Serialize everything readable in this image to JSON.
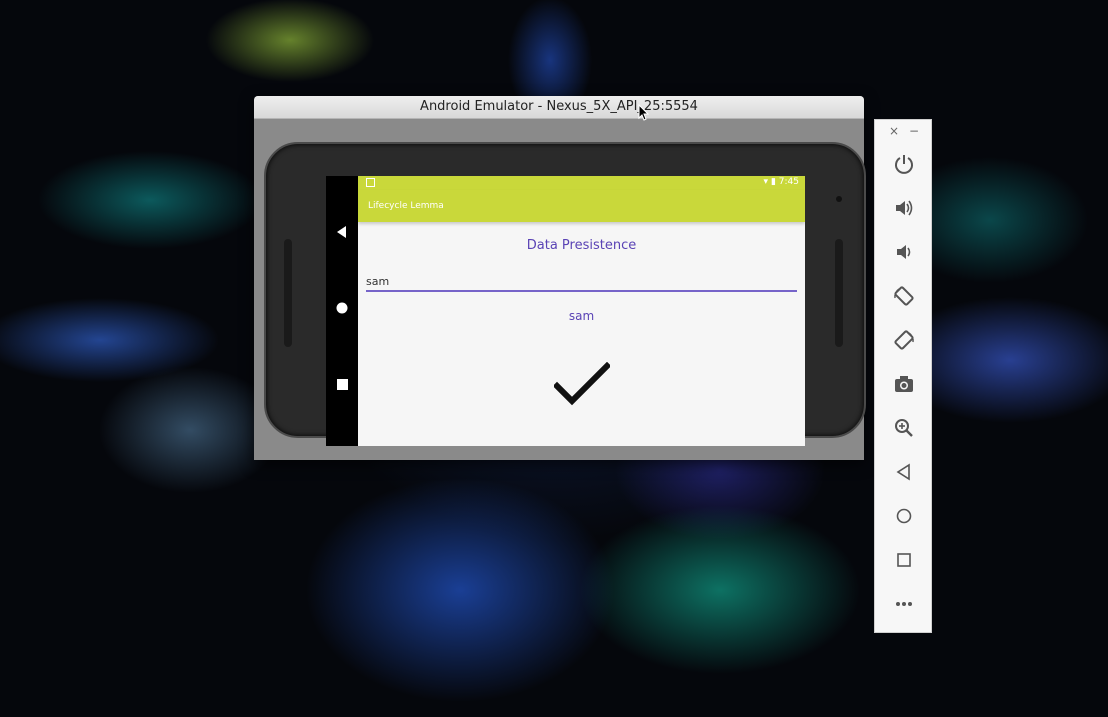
{
  "window": {
    "title": "Android Emulator - Nexus_5X_API_25:5554"
  },
  "status_bar": {
    "time": "7:45"
  },
  "app": {
    "title": "Lifecycle Lemma",
    "heading": "Data Presistence",
    "input_value": "sam",
    "echo_text": "sam"
  },
  "toolbar": {
    "close_glyph": "×",
    "minimize_glyph": "−",
    "buttons": [
      "power-icon",
      "volume-up-icon",
      "volume-down-icon",
      "rotate-left-icon",
      "rotate-right-icon",
      "camera-icon",
      "zoom-icon",
      "back-icon",
      "home-icon",
      "overview-icon",
      "more-icon"
    ]
  },
  "colors": {
    "app_bar": "#c9d83a",
    "accent": "#5a43b5"
  }
}
